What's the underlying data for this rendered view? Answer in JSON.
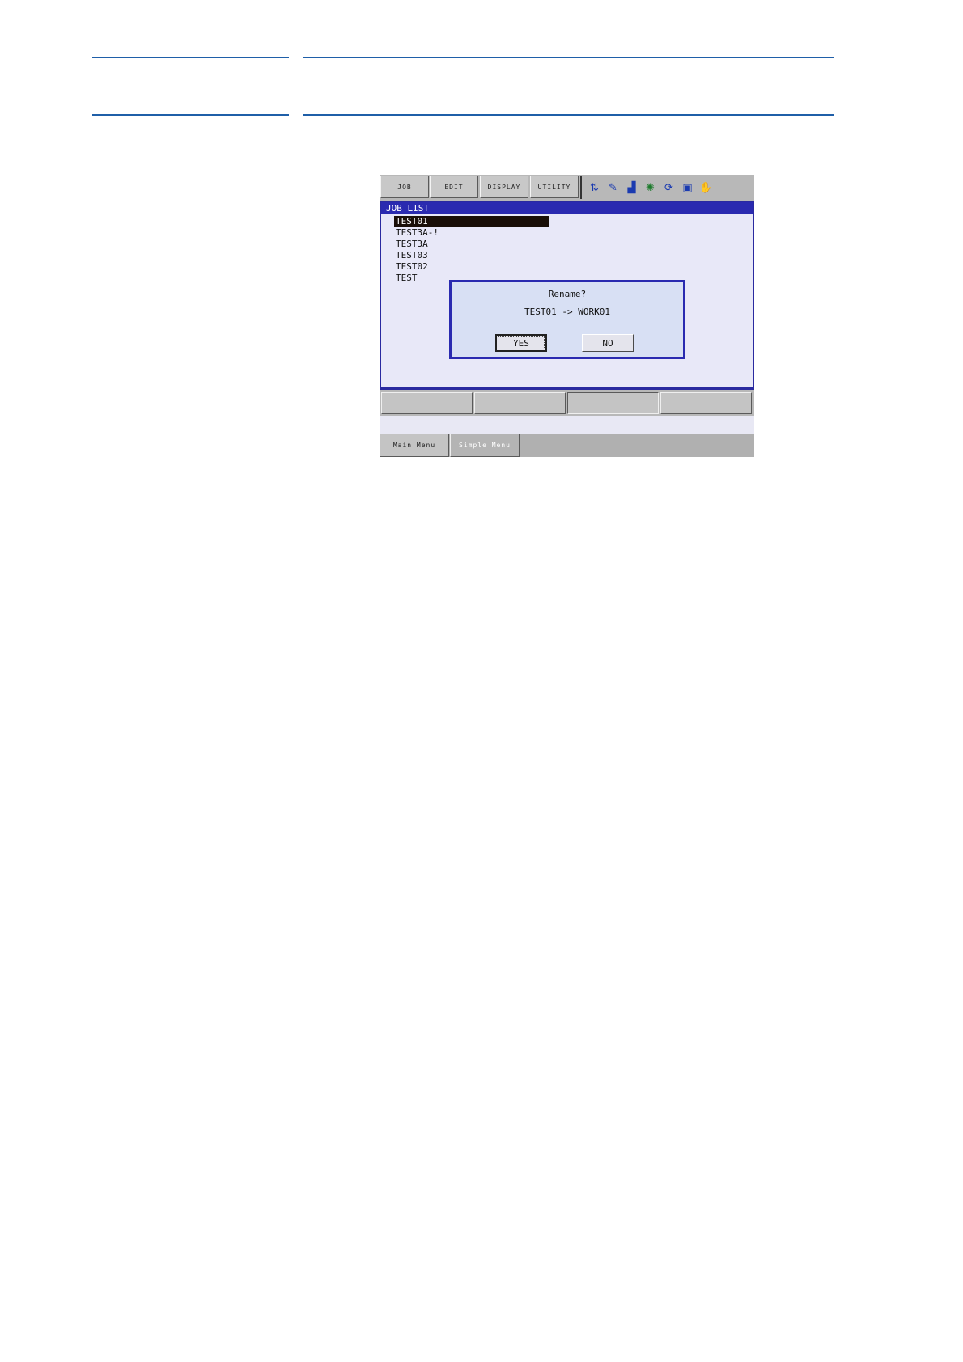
{
  "menubar": {
    "items": [
      {
        "label": "JOB"
      },
      {
        "label": "EDIT"
      },
      {
        "label": "DISPLAY"
      },
      {
        "label": "UTILITY"
      }
    ],
    "status_icons": [
      {
        "name": "coordinate-icon",
        "glyph": "⇅",
        "color": "#1a3ab0"
      },
      {
        "name": "edit-mode-icon",
        "glyph": "✎",
        "color": "#1a3ab0"
      },
      {
        "name": "speed-icon",
        "glyph": "▟",
        "color": "#1a3ab0"
      },
      {
        "name": "robot-icon",
        "glyph": "✺",
        "color": "#1a7a2a"
      },
      {
        "name": "cycle-icon",
        "glyph": "⟳",
        "color": "#1a3ab0"
      },
      {
        "name": "play-icon",
        "glyph": "▣",
        "color": "#1a3ab0"
      },
      {
        "name": "teach-pendant-icon",
        "glyph": "✋",
        "color": "#c8a000"
      }
    ]
  },
  "main": {
    "title": "JOB LIST",
    "jobs": [
      {
        "label": "TEST01"
      },
      {
        "label": "TEST3A-!"
      },
      {
        "label": "TEST3A"
      },
      {
        "label": "TEST03"
      },
      {
        "label": "TEST02"
      },
      {
        "label": "TEST"
      }
    ]
  },
  "dialog": {
    "title": "Rename?",
    "message": "TEST01 -> WORK01",
    "yes_label": "YES",
    "no_label": "NO"
  },
  "bottombar": {
    "main_menu_label": "Main Menu",
    "simple_menu_label": "Simple Menu"
  },
  "colors": {
    "accent": "#2a2ab0",
    "rule": "#1f5fa8"
  }
}
